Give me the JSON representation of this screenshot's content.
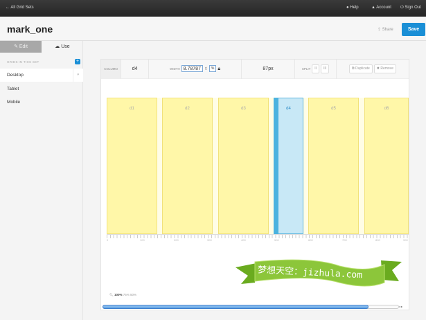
{
  "topbar": {
    "back": "← All Grid Sets",
    "help": "Help",
    "account": "Account",
    "signout": "Sign Out"
  },
  "header": {
    "title": "mark_one",
    "share": "Share",
    "save": "Save"
  },
  "sidebar": {
    "tabs": [
      "Edit",
      "Use"
    ],
    "set_label": "GRIDS IN THIS SET",
    "add": "+",
    "items": [
      "Desktop",
      "Tablet",
      "Mobile"
    ],
    "active": "Desktop"
  },
  "toolbar": {
    "column_label": "COLUMN",
    "column_value": "d4",
    "width_label": "WIDTH",
    "width_value": "8.78787",
    "unit": "%",
    "px": "87px",
    "split_label": "SPLIT",
    "split2": "II",
    "split3": "III",
    "duplicate": "Duplicate",
    "remove": "Remove"
  },
  "columns": [
    {
      "label": "d1"
    },
    {
      "label": "d2"
    },
    {
      "label": "d3"
    },
    {
      "label": "d4",
      "selected": true
    },
    {
      "label": "d5"
    },
    {
      "label": "d6"
    }
  ],
  "ruler": [
    "0",
    "100",
    "200",
    "300",
    "400",
    "500",
    "600",
    "700",
    "800",
    "900"
  ],
  "zoom": {
    "options": [
      "100%",
      "75%",
      "50%"
    ],
    "active": "100%"
  },
  "watermark": "梦想天空：jizhula.com",
  "colors": {
    "accent": "#1a8fd6",
    "column": "#fff7a8",
    "selected": "#c8e8f6"
  }
}
